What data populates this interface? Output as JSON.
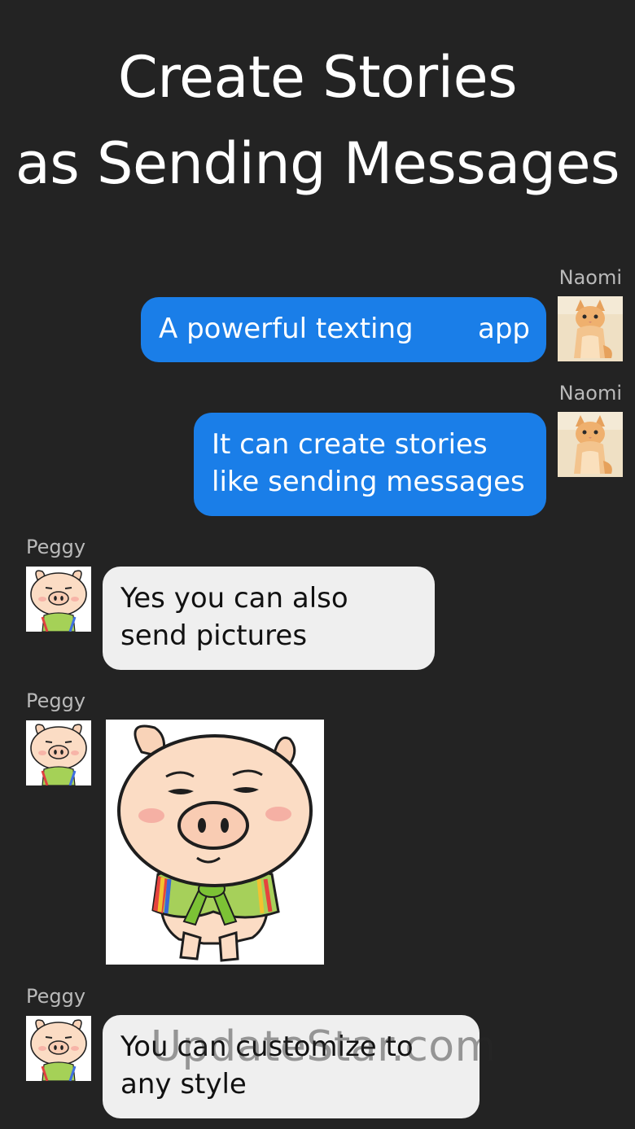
{
  "headline": {
    "line1": "Create Stories",
    "line2": "as Sending Messages"
  },
  "messages": [
    {
      "sender": "Naomi",
      "side": "right",
      "avatar": "kitten-avatar",
      "text_part1": "A powerful texting",
      "text_part2": "app"
    },
    {
      "sender": "Naomi",
      "side": "right",
      "avatar": "kitten-avatar",
      "text": "It can create stories like sending messages"
    },
    {
      "sender": "Peggy",
      "side": "left",
      "avatar": "pig-avatar",
      "text": "Yes you can also send pictures"
    },
    {
      "sender": "Peggy",
      "side": "left",
      "avatar": "pig-avatar",
      "image": "pig-sticker"
    },
    {
      "sender": "Peggy",
      "side": "left",
      "avatar": "pig-avatar",
      "text": "You can customize to any style"
    }
  ],
  "watermark": "UpdateStar.com",
  "colors": {
    "background": "#232323",
    "outgoing_bubble": "#1a7ee8",
    "incoming_bubble": "#efefef",
    "sender_name": "#b9b9b9"
  }
}
